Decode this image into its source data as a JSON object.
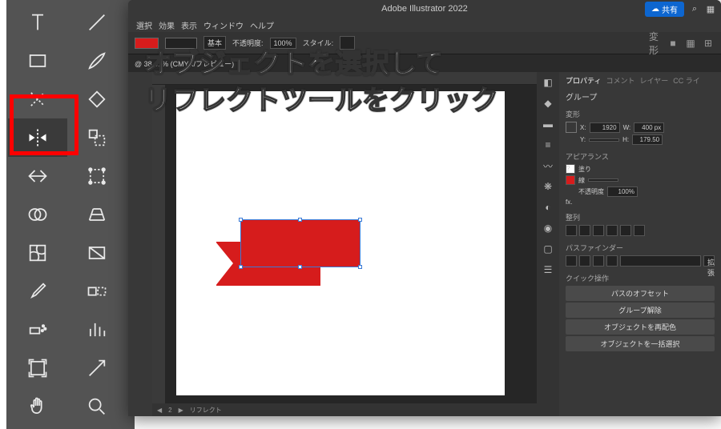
{
  "app": {
    "title": "Adobe Illustrator 2022"
  },
  "titlebar": {
    "share": "共有"
  },
  "menubar": {
    "items": [
      "選択",
      "効果",
      "表示",
      "ウィンドウ",
      "ヘルプ"
    ]
  },
  "control_bar": {
    "stroke_style": "基本",
    "opacity_label": "不透明度:",
    "opacity_value": "100%",
    "style_label": "スタイル:"
  },
  "doc_tab": {
    "label": "@ 38.41% (CMYK/プレビュー)"
  },
  "bottom_bar": {
    "zoom": "",
    "artboard_nav": "2",
    "tool_name": "リフレクト"
  },
  "properties": {
    "tabs": [
      "プロパティ",
      "コメント",
      "レイヤー",
      "CC ライ"
    ],
    "group_label": "グループ",
    "transform": {
      "title": "変形",
      "x_label": "X:",
      "x_value": "1920",
      "w_label": "W:",
      "w_value": "400 px",
      "y_label": "Y:",
      "y_value": "",
      "h_label": "H:",
      "h_value": "179.50"
    },
    "appearance": {
      "title": "アピアランス",
      "fill_label": "塗り",
      "stroke_label": "線",
      "opacity_label": "不透明度",
      "opacity_value": "100%",
      "fx": "fx."
    },
    "align": {
      "title": "整列"
    },
    "pathfinder": {
      "title": "パスファインダー",
      "expand": "拡張"
    },
    "quick": {
      "title": "クイック操作",
      "offset": "パスのオフセット",
      "ungroup": "グループ解除",
      "recolor": "オブジェクトを再配色",
      "select_all": "オブジェクトを一括選択"
    }
  },
  "overlay": {
    "line1": "オブジェクトを選択して",
    "line2": "リフレクトツールをクリック"
  },
  "right_strip_icons": [
    "swatches",
    "color",
    "stroke",
    "brush",
    "symbols",
    "graphic-styles",
    "layers",
    "artboards",
    "links",
    "actions"
  ]
}
